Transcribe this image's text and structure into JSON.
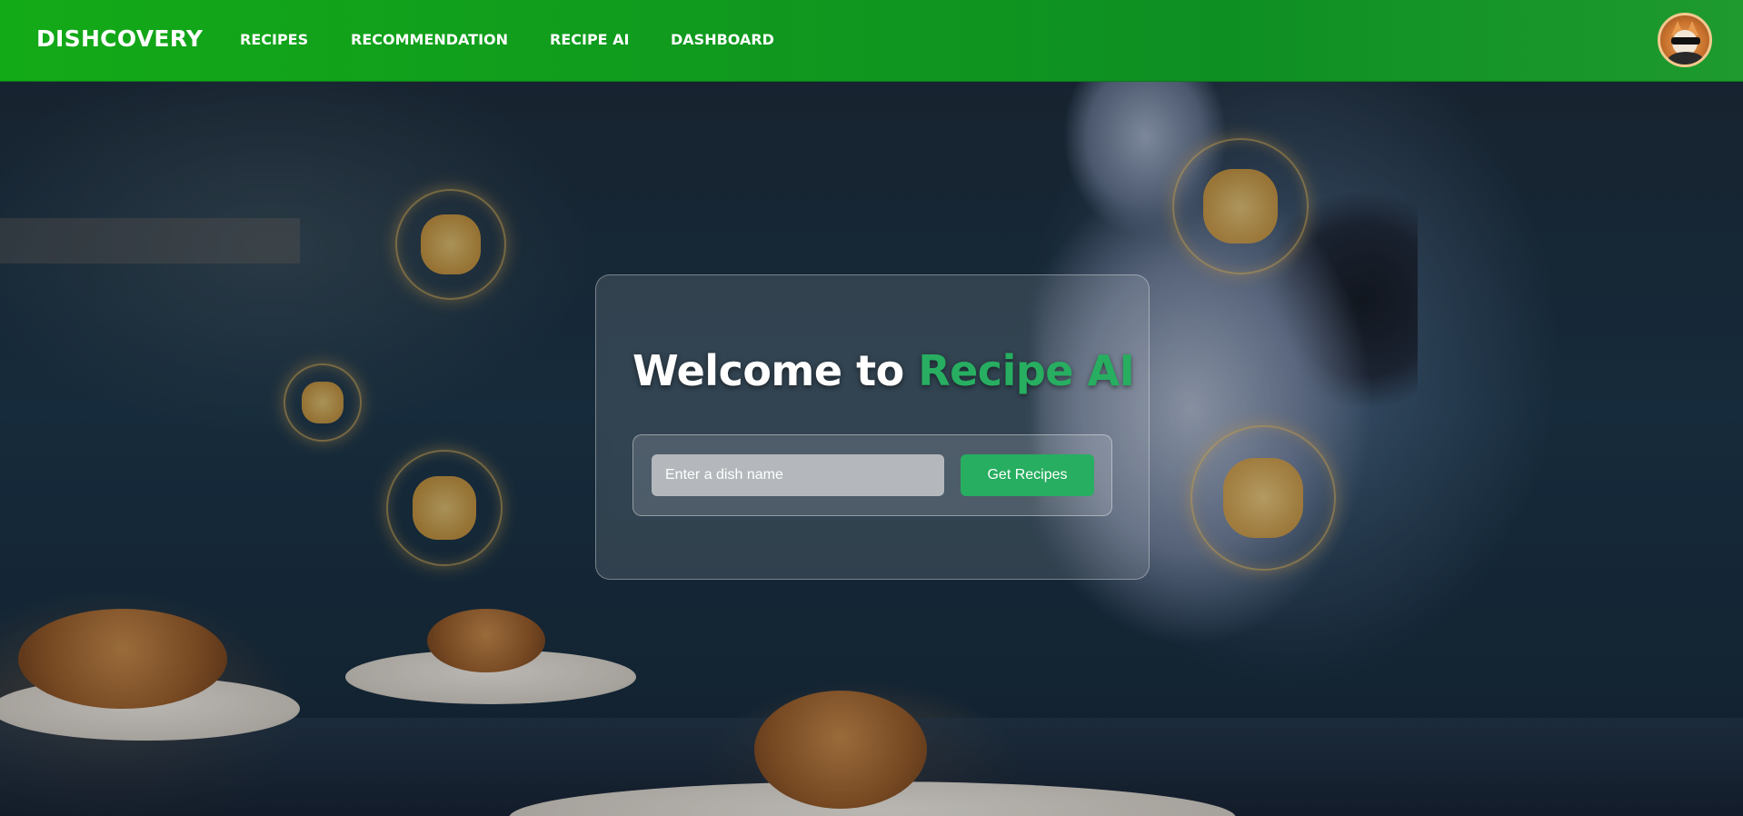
{
  "navbar": {
    "brand": "DISHCOVERY",
    "links": [
      "RECIPES",
      "RECOMMENDATION",
      "RECIPE AI",
      "DASHBOARD"
    ],
    "avatar_icon": "user-avatar-icon"
  },
  "hero": {
    "title_prefix": "Welcome to",
    "title_accent": "Recipe AI",
    "search": {
      "placeholder": "Enter a dish name",
      "value": ""
    },
    "button_label": "Get Recipes"
  },
  "colors": {
    "navbar": "#13aa17",
    "accent": "#27ae60",
    "button": "#27ae60",
    "text": "#ffffff"
  }
}
